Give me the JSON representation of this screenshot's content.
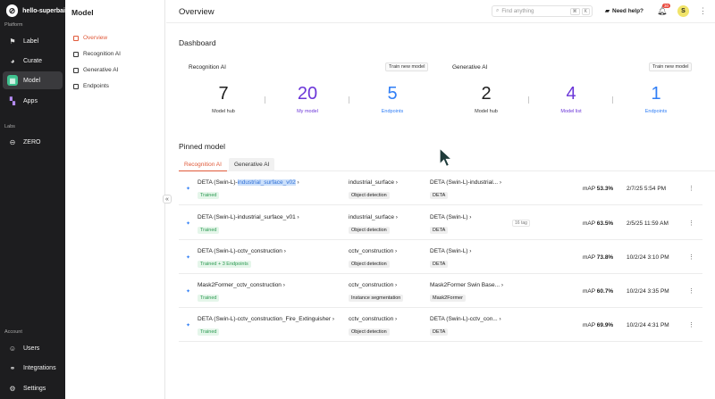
{
  "app": {
    "workspace": "hello-superbai"
  },
  "sidebar": {
    "sections": {
      "platform": "Platform",
      "labs": "Labs",
      "account": "Account"
    },
    "items": [
      {
        "label": "Label",
        "icon": "label-icon"
      },
      {
        "label": "Curate",
        "icon": "curate-icon"
      },
      {
        "label": "Model",
        "icon": "model-icon"
      },
      {
        "label": "Apps",
        "icon": "apps-icon"
      },
      {
        "label": "ZERO",
        "icon": "zero-icon"
      },
      {
        "label": "Users",
        "icon": "users-icon"
      },
      {
        "label": "Integrations",
        "icon": "integrations-icon"
      },
      {
        "label": "Settings",
        "icon": "settings-icon"
      }
    ]
  },
  "subnav": {
    "title": "Model",
    "items": [
      "Overview",
      "Recognition AI",
      "Generative AI",
      "Endpoints"
    ]
  },
  "header": {
    "title": "Overview",
    "search_placeholder": "Find anything",
    "shortcut": [
      "⌘",
      "K"
    ],
    "help": "Need help?",
    "notif_count": "30",
    "avatar_initial": "S"
  },
  "dashboard": {
    "title": "Dashboard",
    "recognition": {
      "title": "Recognition AI",
      "button": "Train new model",
      "stats": [
        {
          "value": "7",
          "label": "Model hub"
        },
        {
          "value": "20",
          "label": "My model"
        },
        {
          "value": "5",
          "label": "Endpoints"
        }
      ]
    },
    "generative": {
      "title": "Generative AI",
      "button": "Train new model",
      "stats": [
        {
          "value": "2",
          "label": "Model hub"
        },
        {
          "value": "4",
          "label": "Model list"
        },
        {
          "value": "1",
          "label": "Endpoints"
        }
      ]
    }
  },
  "pinned": {
    "title": "Pinned model",
    "tabs": [
      "Recognition AI",
      "Generative AI"
    ],
    "rows": [
      {
        "name_prefix": "DETA (Swin-L)-",
        "name_highlight": "industrial_surface_v02",
        "status": "Trained",
        "dataset": "industrial_surface",
        "task": "Object detection",
        "arch": "DETA (Swin-L)-industrial...",
        "arch_tag": "DETA",
        "extra": "",
        "map_label": "mAP",
        "map": "53.3%",
        "date": "2/7/25 5:54 PM"
      },
      {
        "name_prefix": "DETA (Swin-L)-industrial_surface_v01",
        "name_highlight": "",
        "status": "Trained",
        "dataset": "industrial_surface",
        "task": "Object detection",
        "arch": "DETA (Swin-L)",
        "arch_tag": "DETA",
        "extra": "16 tag",
        "map_label": "mAP",
        "map": "63.5%",
        "date": "2/5/25 11:59 AM"
      },
      {
        "name_prefix": "DETA (Swin-L)-cctv_construction",
        "name_highlight": "",
        "status": "Trained + 3 Endpoints",
        "dataset": "cctv_construction",
        "task": "Object detection",
        "arch": "DETA (Swin-L)",
        "arch_tag": "DETA",
        "extra": "",
        "map_label": "mAP",
        "map": "73.8%",
        "date": "10/2/24 3:10 PM"
      },
      {
        "name_prefix": "Mask2Former_cctv_construction",
        "name_highlight": "",
        "status": "Trained",
        "dataset": "cctv_construction",
        "task": "Instance segmentation",
        "arch": "Mask2Former Swin Base...",
        "arch_tag": "Mask2Former",
        "extra": "",
        "map_label": "mAP",
        "map": "60.7%",
        "date": "10/2/24 3:35 PM"
      },
      {
        "name_prefix": "DETA (Swin-L)-cctv_construction_Fire_Extinguisher",
        "name_highlight": "",
        "status": "Trained",
        "dataset": "cctv_construction",
        "task": "Object detection",
        "arch": "DETA (Swin-L)-cctv_con...",
        "arch_tag": "DETA",
        "extra": "",
        "map_label": "mAP",
        "map": "69.9%",
        "date": "10/2/24 4:31 PM"
      }
    ]
  },
  "colors": {
    "accent": "#e05a3a",
    "purple": "#6b36d8",
    "blue": "#2f7ef6",
    "green": "#3fc28f",
    "sidebar": "#1d1d1f"
  }
}
